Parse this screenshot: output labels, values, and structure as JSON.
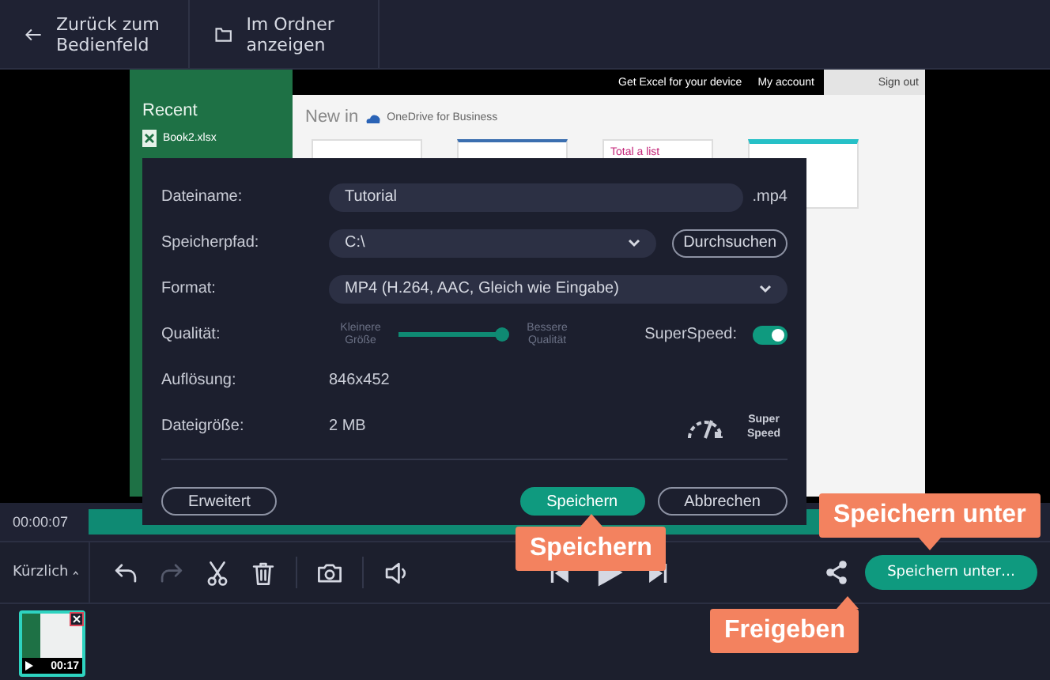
{
  "top_bar": [
    {
      "kind": "back",
      "label": "Zurück zum Bedienfeld"
    },
    {
      "kind": "folder",
      "label": "Im Ordner anzeigen"
    }
  ],
  "preview": {
    "sidebar_title": "Recent",
    "recent_file": "Book2.xlsx",
    "header_links": [
      "Get Excel for your device",
      "My account"
    ],
    "sign_out": "Sign out",
    "new_in": "New in",
    "cloud_name": "OneDrive for Business",
    "card_title": "Total a list"
  },
  "dialog": {
    "filename_label": "Dateiname:",
    "filename": "Tutorial",
    "extension": ".mp4",
    "path_label": "Speicherpfad:",
    "path": "C:\\",
    "browse": "Durchsuchen",
    "format_label": "Format:",
    "format": "MP4 (H.264, AAC, Gleich wie Eingabe)",
    "quality_label": "Qualität:",
    "quality_low": "Kleinere Größe",
    "quality_high": "Bessere Qualität",
    "quality": {
      "level": 1
    },
    "superspeed_label": "SuperSpeed:",
    "superspeed_on": true,
    "resolution_label": "Auflösung:",
    "resolution": "846x452",
    "size_label": "Dateigröße:",
    "size": "2 MB",
    "speed_badge": "Super Speed",
    "buttons": [
      {
        "kind": "outline",
        "label": "Erweitert"
      },
      {
        "kind": "primary",
        "label": "Speichern"
      },
      {
        "kind": "outline",
        "label": "Abbrechen"
      }
    ]
  },
  "timeline": {
    "time": "00:00:07"
  },
  "toolbar": {
    "recent": "Kürzlich",
    "tools": [
      {
        "kind": "undo",
        "disabled": false
      },
      {
        "kind": "redo",
        "disabled": true
      },
      {
        "kind": "cut",
        "disabled": false
      },
      {
        "kind": "delete",
        "disabled": false
      },
      {
        "kind": "camera",
        "disabled": false
      },
      {
        "kind": "volume",
        "disabled": false
      },
      {
        "kind": "prev",
        "disabled": false
      },
      {
        "kind": "play",
        "disabled": false
      },
      {
        "kind": "next",
        "disabled": false
      }
    ],
    "save_as": "Speichern unter…"
  },
  "clips": [
    {
      "duration": "00:17",
      "selected": true
    }
  ],
  "callouts": [
    {
      "text": "Speichern"
    },
    {
      "text": "Speichern unter"
    },
    {
      "text": "Freigeben"
    }
  ]
}
